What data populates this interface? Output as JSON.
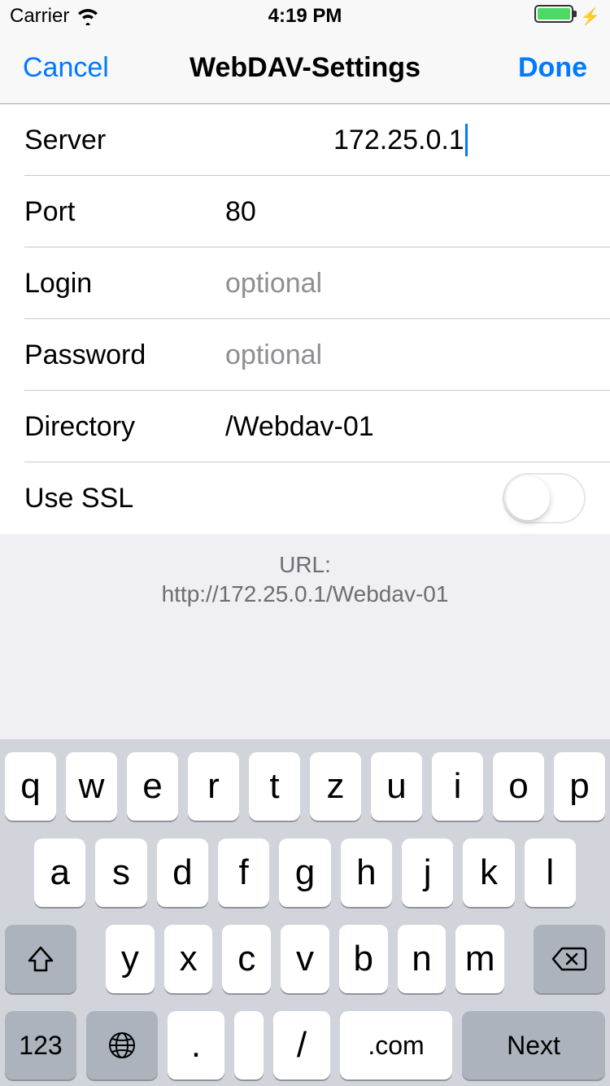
{
  "status_bar": {
    "carrier": "Carrier",
    "time": "4:19 PM"
  },
  "nav": {
    "cancel": "Cancel",
    "title": "WebDAV-Settings",
    "done": "Done"
  },
  "form": {
    "server": {
      "label": "Server",
      "value": "172.25.0.1"
    },
    "port": {
      "label": "Port",
      "value": "80"
    },
    "login": {
      "label": "Login",
      "value": "",
      "placeholder": "optional"
    },
    "password": {
      "label": "Password",
      "value": "",
      "placeholder": "optional"
    },
    "directory": {
      "label": "Directory",
      "value": "/Webdav-01"
    },
    "use_ssl": {
      "label": "Use SSL",
      "on": false
    }
  },
  "url_footer": {
    "label": "URL:",
    "value": "http://172.25.0.1/Webdav-01"
  },
  "keyboard": {
    "row1": [
      "q",
      "w",
      "e",
      "r",
      "t",
      "z",
      "u",
      "i",
      "o",
      "p"
    ],
    "row2": [
      "a",
      "s",
      "d",
      "f",
      "g",
      "h",
      "j",
      "k",
      "l"
    ],
    "row3": [
      "y",
      "x",
      "c",
      "v",
      "b",
      "n",
      "m"
    ],
    "k123": "123",
    "dot": ".",
    "slash": "/",
    "space": "",
    "com": ".com",
    "next": "Next"
  }
}
